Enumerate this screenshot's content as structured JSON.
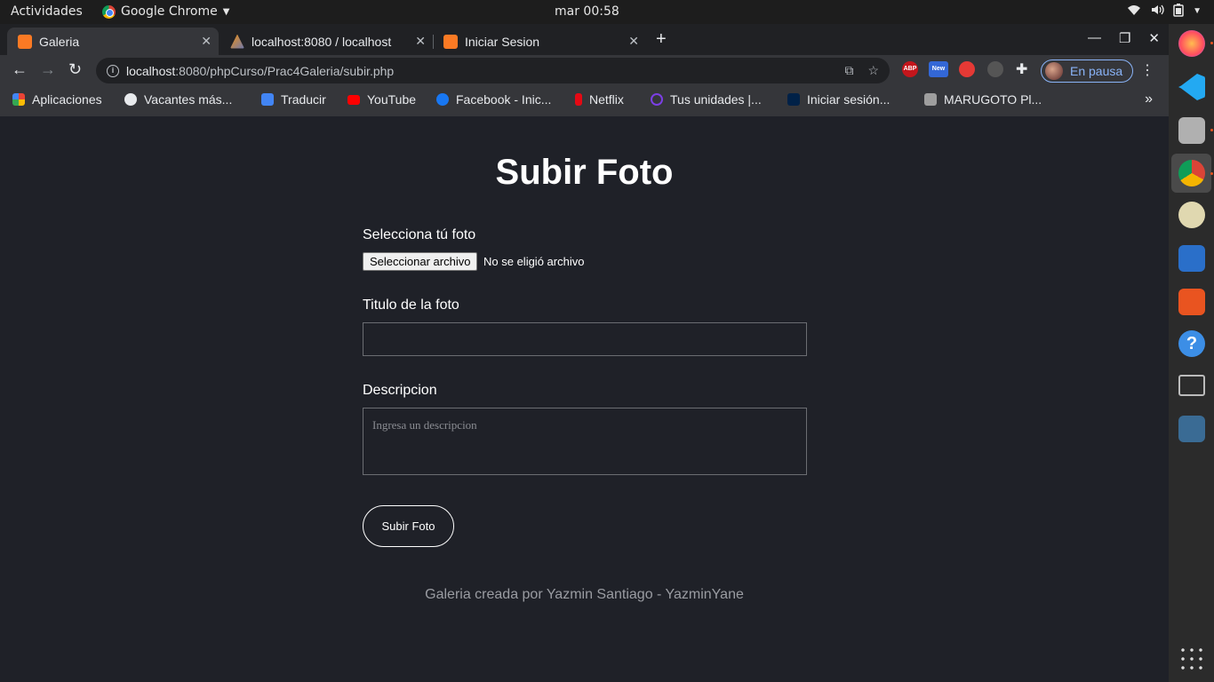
{
  "system_bar": {
    "activities": "Actividades",
    "app_name": "Google Chrome",
    "clock": "mar 00:58"
  },
  "tabs": [
    {
      "title": "Galeria",
      "active": true
    },
    {
      "title": "localhost:8080 / localhost",
      "active": false
    },
    {
      "title": "Iniciar Sesion",
      "active": false
    }
  ],
  "address_bar": {
    "host": "localhost",
    "path": ":8080/phpCurso/Prac4Galeria/subir.php"
  },
  "profile": {
    "label": "En pausa"
  },
  "extensions": [
    "ABP",
    "New"
  ],
  "bookmarks": [
    "Aplicaciones",
    "Vacantes más...",
    "Traducir",
    "YouTube",
    "Facebook - Inic...",
    "Netflix",
    "Tus unidades |...",
    "Iniciar sesión...",
    "MARUGOTO Pl..."
  ],
  "page": {
    "title": "Subir Foto",
    "file_label": "Selecciona tú foto",
    "file_button": "Seleccionar archivo",
    "file_status": "No se eligió archivo",
    "title_label": "Titulo de la foto",
    "title_value": "",
    "description_label": "Descripcion",
    "description_placeholder": "Ingresa un descripcion",
    "submit_label": "Subir Foto",
    "footer": "Galeria creada por Yazmin Santiago - YazminYane"
  },
  "colors": {
    "page_bg": "#1f2128",
    "chrome_bg": "#35363a",
    "tabstrip_bg": "#202124",
    "profile_accent": "#8ab4f8"
  }
}
